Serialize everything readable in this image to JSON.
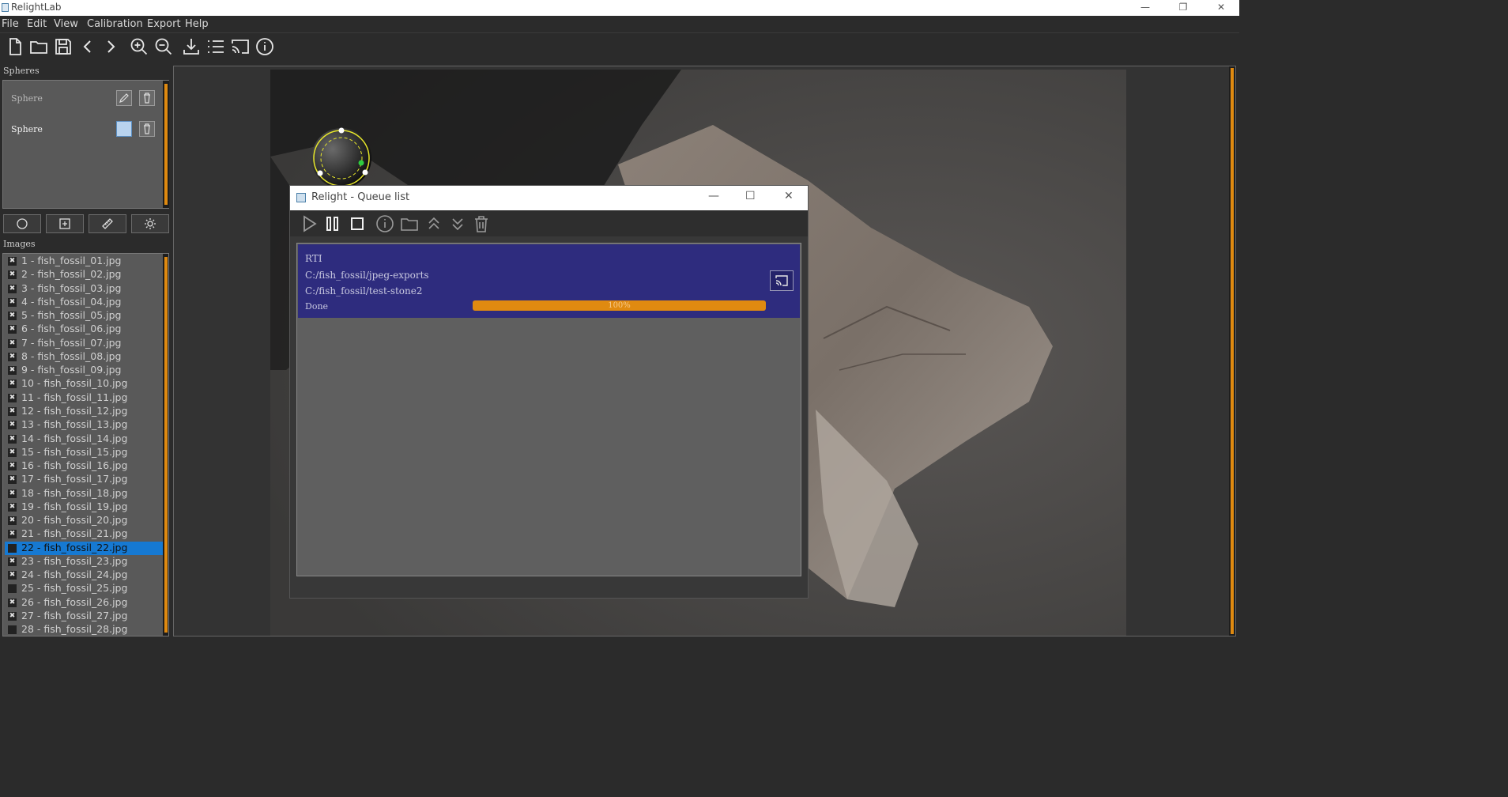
{
  "window": {
    "title": "RelightLab",
    "minimize": "—",
    "restore": "❐",
    "close": "✕"
  },
  "menu": [
    "File",
    "Edit",
    "View",
    "Calibration",
    "Export",
    "Help"
  ],
  "toolbar_icons": [
    "new-file-icon",
    "open-folder-icon",
    "save-icon",
    "back-icon",
    "forward-icon",
    "zoom-in-icon",
    "zoom-out-icon",
    "download-icon",
    "list-icon",
    "cast-icon",
    "info-icon"
  ],
  "spheres": {
    "title": "Spheres",
    "items": [
      {
        "label": "Sphere",
        "active": false
      },
      {
        "label": "Sphere",
        "active": true
      }
    ]
  },
  "tools": [
    "circle-icon",
    "add-box-icon",
    "ruler-icon",
    "sun-icon"
  ],
  "images": {
    "title": "Images",
    "items": [
      {
        "label": "1 - fish_fossil_01.jpg",
        "checked": true
      },
      {
        "label": "2 - fish_fossil_02.jpg",
        "checked": true
      },
      {
        "label": "3 - fish_fossil_03.jpg",
        "checked": true
      },
      {
        "label": "4 - fish_fossil_04.jpg",
        "checked": true
      },
      {
        "label": "5 - fish_fossil_05.jpg",
        "checked": true
      },
      {
        "label": "6 - fish_fossil_06.jpg",
        "checked": true
      },
      {
        "label": "7 - fish_fossil_07.jpg",
        "checked": true
      },
      {
        "label": "8 - fish_fossil_08.jpg",
        "checked": true
      },
      {
        "label": "9 - fish_fossil_09.jpg",
        "checked": true
      },
      {
        "label": "10 - fish_fossil_10.jpg",
        "checked": true
      },
      {
        "label": "11 - fish_fossil_11.jpg",
        "checked": true
      },
      {
        "label": "12 - fish_fossil_12.jpg",
        "checked": true
      },
      {
        "label": "13 - fish_fossil_13.jpg",
        "checked": true
      },
      {
        "label": "14 - fish_fossil_14.jpg",
        "checked": true
      },
      {
        "label": "15 - fish_fossil_15.jpg",
        "checked": true
      },
      {
        "label": "16 - fish_fossil_16.jpg",
        "checked": true
      },
      {
        "label": "17 - fish_fossil_17.jpg",
        "checked": true
      },
      {
        "label": "18 - fish_fossil_18.jpg",
        "checked": true
      },
      {
        "label": "19 - fish_fossil_19.jpg",
        "checked": true
      },
      {
        "label": "20 - fish_fossil_20.jpg",
        "checked": true
      },
      {
        "label": "21 - fish_fossil_21.jpg",
        "checked": true
      },
      {
        "label": "22 - fish_fossil_22.jpg",
        "checked": false,
        "selected": true
      },
      {
        "label": "23 - fish_fossil_23.jpg",
        "checked": true
      },
      {
        "label": "24 - fish_fossil_24.jpg",
        "checked": true
      },
      {
        "label": "25 - fish_fossil_25.jpg",
        "checked": false
      },
      {
        "label": "26 - fish_fossil_26.jpg",
        "checked": true
      },
      {
        "label": "27 - fish_fossil_27.jpg",
        "checked": true
      },
      {
        "label": "28 - fish_fossil_28.jpg",
        "checked": false
      }
    ]
  },
  "dialog": {
    "title": "Relight - Queue list",
    "minimize": "—",
    "maximize": "☐",
    "close": "✕",
    "tools": [
      "play-icon",
      "pause-icon",
      "stop-icon",
      "info-icon",
      "folder-icon",
      "move-up-icon",
      "move-down-icon",
      "trash-icon"
    ],
    "job": {
      "type": "RTI",
      "input": "C:/fish_fossil/jpeg-exports",
      "output": "C:/fish_fossil/test-stone2",
      "status": "Done",
      "progress_label": "100%",
      "progress": 1.0
    }
  },
  "colors": {
    "accent": "#e08a10",
    "selection": "#1679d2",
    "job_bg": "#2e2c7e"
  }
}
